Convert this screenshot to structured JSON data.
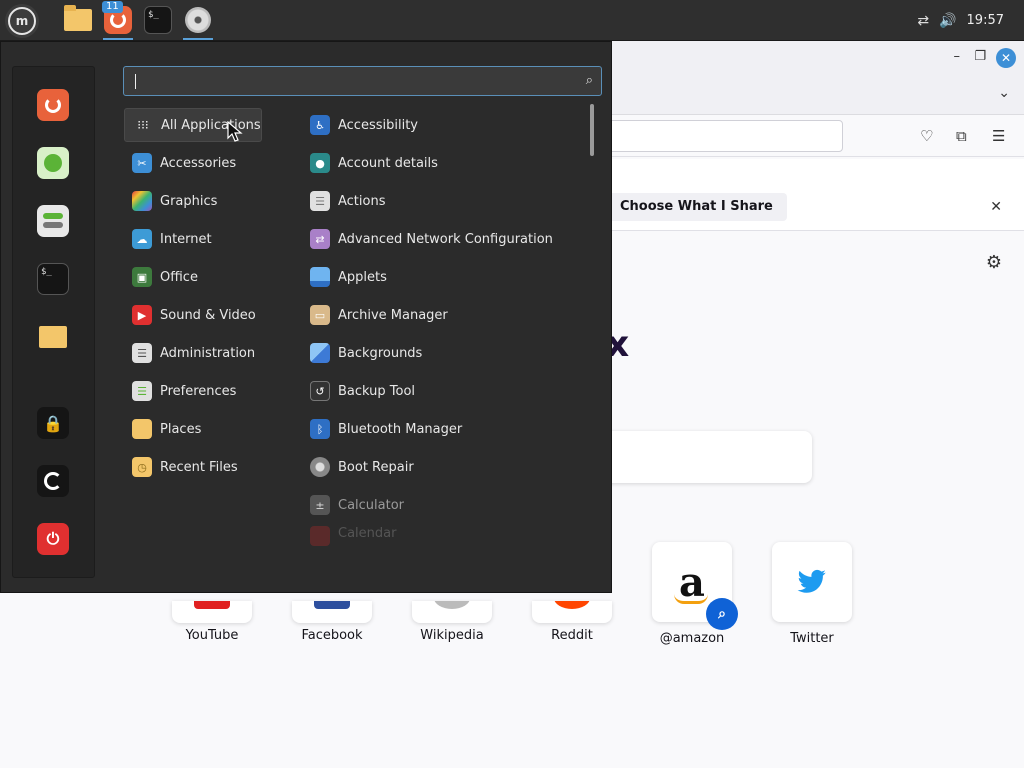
{
  "panel": {
    "clock": "19:57",
    "firefox_badge": "11",
    "launchers": [
      "menu-icon",
      "folder-icon",
      "firefox-icon",
      "terminal-icon",
      "disc-icon"
    ],
    "tray_icons": [
      "network-disconnected-icon",
      "volume-icon"
    ]
  },
  "browser": {
    "notification_button": "Choose What I Share",
    "logo_fragment": "x",
    "top_sites": [
      {
        "label": "YouTube"
      },
      {
        "label": "Facebook"
      },
      {
        "label": "Wikipedia"
      },
      {
        "label": "Reddit"
      },
      {
        "label": "@amazon"
      },
      {
        "label": "Twitter"
      }
    ],
    "amazon_logo": "a"
  },
  "menu": {
    "search": {
      "value": ""
    },
    "favorites": [
      "firefox-icon",
      "calculator-icon",
      "settings-icon",
      "terminal-icon",
      "folder-icon",
      "lock-icon",
      "logout-icon",
      "power-icon"
    ],
    "categories": [
      {
        "label": "All Applications",
        "selected": true
      },
      {
        "label": "Accessories"
      },
      {
        "label": "Graphics"
      },
      {
        "label": "Internet"
      },
      {
        "label": "Office"
      },
      {
        "label": "Sound & Video"
      },
      {
        "label": "Administration"
      },
      {
        "label": "Preferences"
      },
      {
        "label": "Places"
      },
      {
        "label": "Recent Files"
      }
    ],
    "apps": [
      {
        "label": "Accessibility"
      },
      {
        "label": "Account details"
      },
      {
        "label": "Actions"
      },
      {
        "label": "Advanced Network Configuration"
      },
      {
        "label": "Applets"
      },
      {
        "label": "Archive Manager"
      },
      {
        "label": "Backgrounds"
      },
      {
        "label": "Backup Tool"
      },
      {
        "label": "Bluetooth Manager"
      },
      {
        "label": "Boot Repair"
      },
      {
        "label": "Calculator"
      },
      {
        "label": "Calendar"
      }
    ]
  },
  "colors": {
    "accent": "#3d8fd6",
    "menu_bg": "#2b2b2b",
    "panel_bg": "#2f2f2f"
  }
}
